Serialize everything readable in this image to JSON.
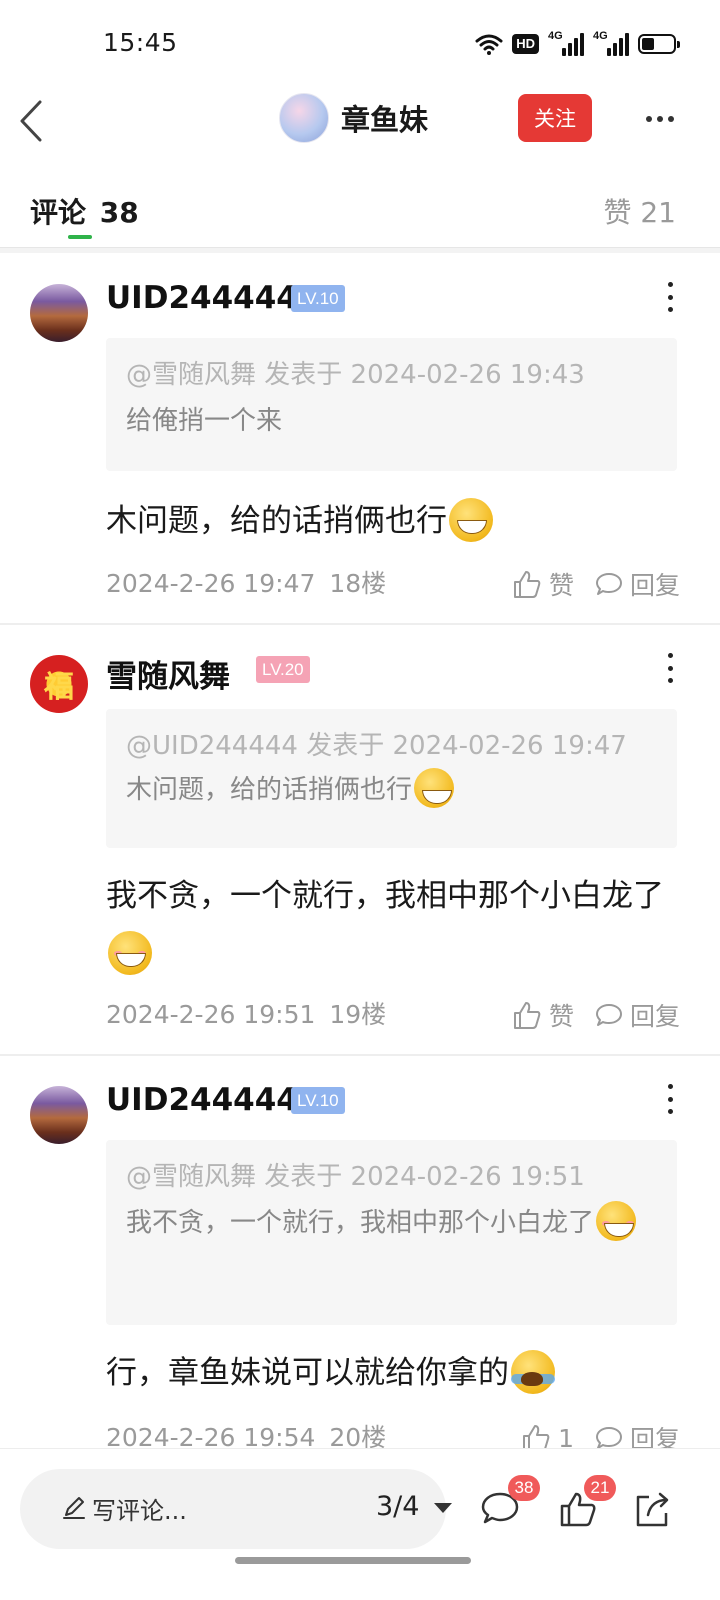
{
  "status_bar": {
    "time": "15:45",
    "hd": "HD",
    "net1": "4G",
    "net2": "4G",
    "battery_level": 0.4
  },
  "nav": {
    "title": "章鱼妹",
    "follow_label": "关注"
  },
  "tabs": {
    "comments_label": "评论",
    "comments_count": "38",
    "likes_label": "赞 21"
  },
  "comments": [
    {
      "name": "UID244444",
      "level": "LV.10",
      "quote_meta": "@雪随风舞 发表于 2024-02-26 19:43",
      "quote_text": "给俺捎一个来",
      "body": "木问题，给的话捎俩也行",
      "time": "2024-2-26 19:47",
      "floor": "18楼",
      "like_label": "赞",
      "reply_label": "回复"
    },
    {
      "name": "雪随风舞",
      "level": "LV.20",
      "avatar_char": "福",
      "quote_meta": "@UID244444 发表于 2024-02-26 19:47",
      "quote_text": "木问题，给的话捎俩也行",
      "body": "我不贪，一个就行，我相中那个小白龙了",
      "time": "2024-2-26 19:51",
      "floor": "19楼",
      "like_label": "赞",
      "reply_label": "回复"
    },
    {
      "name": "UID244444",
      "level": "LV.10",
      "quote_meta": "@雪随风舞 发表于 2024-02-26 19:51",
      "quote_text": "我不贪，一个就行，我相中那个小白龙了",
      "body": "行，章鱼妹说可以就给你拿的",
      "time": "2024-2-26 19:54",
      "floor": "20楼",
      "like_label": "1",
      "reply_label": "回复"
    }
  ],
  "bottom_bar": {
    "write_placeholder": "写评论...",
    "page_indicator": "3/4",
    "comment_badge": "38",
    "like_badge": "21"
  },
  "icons": [
    "back-icon",
    "more-icon",
    "kebab-icon",
    "thumbs-up-icon",
    "reply-bubble-icon",
    "pencil-icon",
    "comment-icon",
    "share-icon"
  ],
  "colors": {
    "follow": "#e53935",
    "tab_indicator": "#2fb34a",
    "badge": "#f05a5a",
    "lv_blue": "#90b4ef",
    "lv_pink": "#f5a3b5"
  }
}
